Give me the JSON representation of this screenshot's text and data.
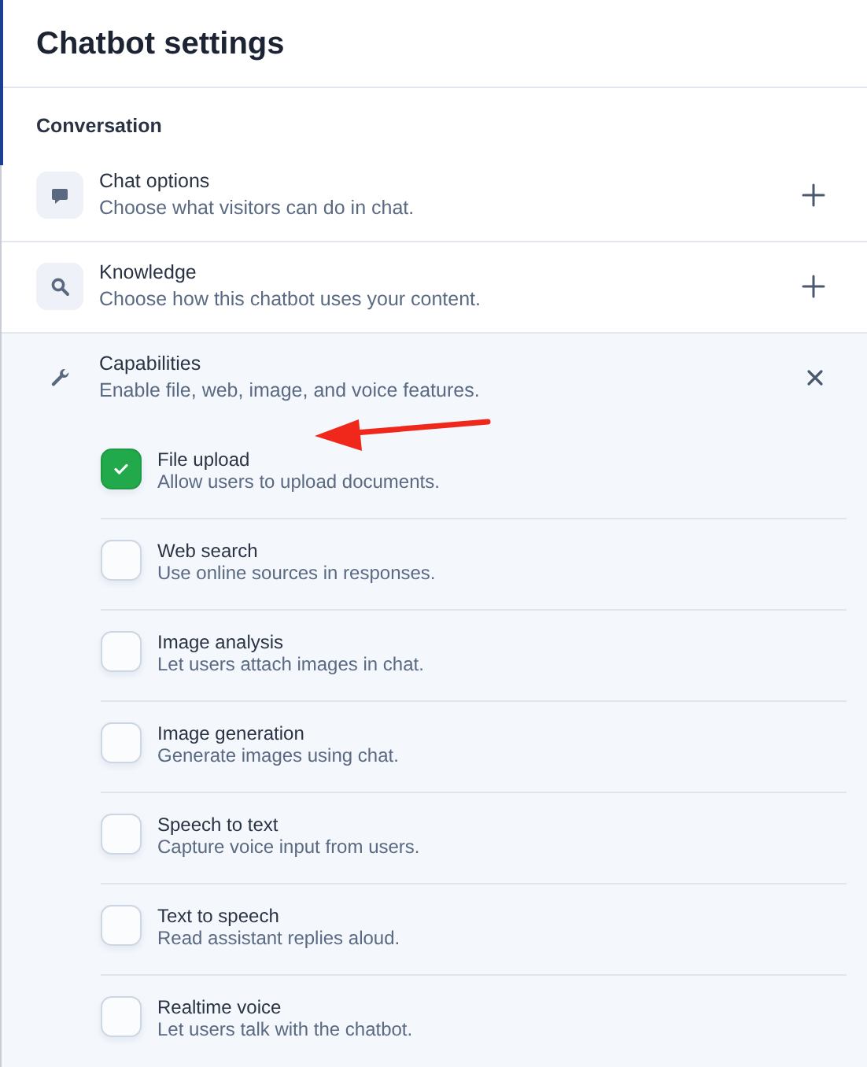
{
  "title": "Chatbot settings",
  "group": {
    "heading": "Conversation",
    "sections": [
      {
        "title": "Chat options",
        "description": "Choose what visitors can do in chat.",
        "expanded": false
      },
      {
        "title": "Knowledge",
        "description": "Choose how this chatbot uses your content.",
        "expanded": false
      },
      {
        "title": "Capabilities",
        "description": "Enable file, web, image, and voice features.",
        "expanded": true,
        "options": [
          {
            "label": "File upload",
            "description": "Allow users to upload documents.",
            "checked": true
          },
          {
            "label": "Web search",
            "description": "Use online sources in responses.",
            "checked": false
          },
          {
            "label": "Image analysis",
            "description": "Let users attach images in chat.",
            "checked": false
          },
          {
            "label": "Image generation",
            "description": "Generate images using chat.",
            "checked": false
          },
          {
            "label": "Speech to text",
            "description": "Capture voice input from users.",
            "checked": false
          },
          {
            "label": "Text to speech",
            "description": "Read assistant replies aloud.",
            "checked": false
          },
          {
            "label": "Realtime voice",
            "description": "Let users talk with the chatbot.",
            "checked": false
          }
        ]
      }
    ]
  }
}
